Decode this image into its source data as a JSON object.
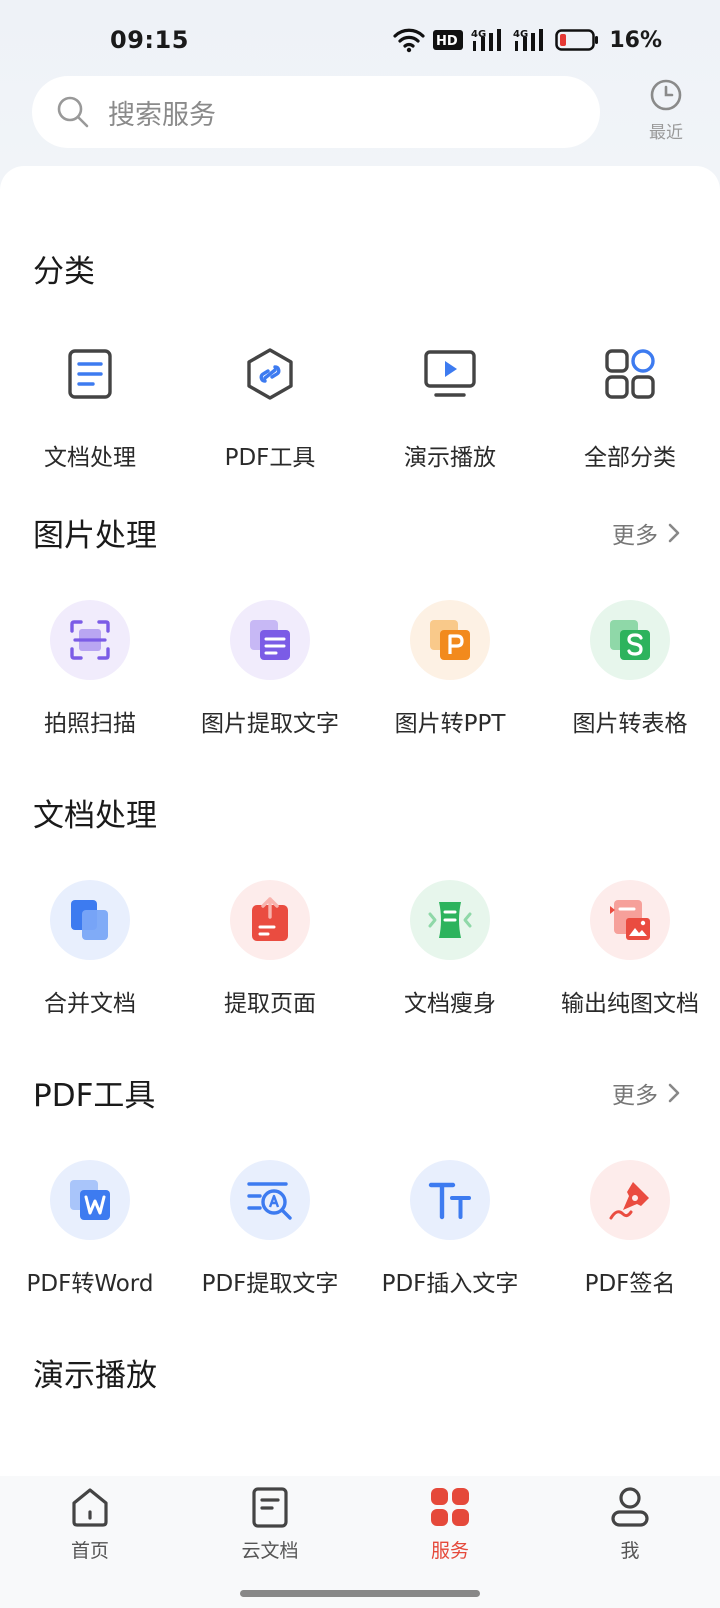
{
  "status_bar": {
    "time": "09:15",
    "battery": "16%",
    "network_a": "4G",
    "network_b": "4G",
    "hd_badge": "HD"
  },
  "search": {
    "placeholder": "搜索服务"
  },
  "recent": {
    "label": "最近"
  },
  "sections": {
    "category": {
      "title": "分类",
      "items": [
        {
          "label": "文档处理",
          "icon": "document-icon"
        },
        {
          "label": "PDF工具",
          "icon": "pdf-hexagon-icon"
        },
        {
          "label": "演示播放",
          "icon": "presentation-icon"
        },
        {
          "label": "全部分类",
          "icon": "grid-icon"
        }
      ]
    },
    "image_processing": {
      "title": "图片处理",
      "more": "更多",
      "items": [
        {
          "label": "拍照扫描",
          "icon": "scan-icon"
        },
        {
          "label": "图片提取文字",
          "icon": "image-text-icon"
        },
        {
          "label": "图片转PPT",
          "icon": "image-ppt-icon"
        },
        {
          "label": "图片转表格",
          "icon": "image-sheet-icon"
        }
      ]
    },
    "document_processing": {
      "title": "文档处理",
      "items": [
        {
          "label": "合并文档",
          "icon": "merge-icon"
        },
        {
          "label": "提取页面",
          "icon": "extract-page-icon"
        },
        {
          "label": "文档瘦身",
          "icon": "compress-icon"
        },
        {
          "label": "输出纯图文档",
          "icon": "image-doc-icon"
        }
      ]
    },
    "pdf_tools": {
      "title": "PDF工具",
      "more": "更多",
      "items": [
        {
          "label": "PDF转Word",
          "icon": "pdf-word-icon"
        },
        {
          "label": "PDF提取文字",
          "icon": "pdf-extract-text-icon"
        },
        {
          "label": "PDF插入文字",
          "icon": "pdf-insert-text-icon"
        },
        {
          "label": "PDF签名",
          "icon": "pdf-sign-icon"
        }
      ]
    },
    "presentation": {
      "title": "演示播放"
    }
  },
  "bottom_nav": {
    "items": [
      {
        "label": "首页",
        "icon": "home-icon"
      },
      {
        "label": "云文档",
        "icon": "cloud-doc-icon"
      },
      {
        "label": "服务",
        "icon": "services-icon",
        "active": true
      },
      {
        "label": "我",
        "icon": "profile-icon"
      }
    ]
  },
  "colors": {
    "accent": "#e5493a",
    "blue": "#3d7bf0",
    "purple": "#7b5ce6",
    "orange": "#f28a1d",
    "green": "#2db35d",
    "red": "#ea4c40"
  }
}
